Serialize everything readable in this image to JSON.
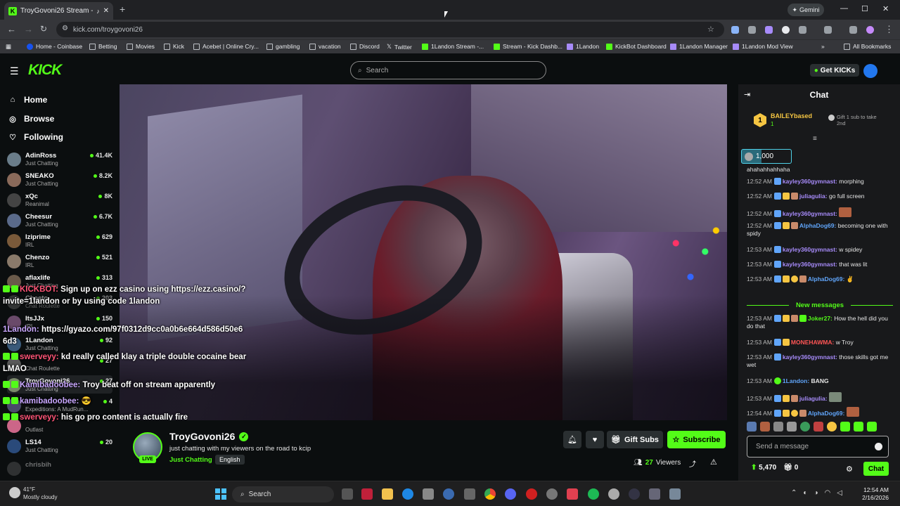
{
  "browser": {
    "tab_title": "TroyGovoni26 Stream - Wa",
    "url": "kick.com/troygovoni26",
    "gemini_label": "Gemini",
    "bookmarks": [
      {
        "label": "Home - Coinbase"
      },
      {
        "label": "Betting"
      },
      {
        "label": "Movies"
      },
      {
        "label": "Kick"
      },
      {
        "label": "Acebet | Online Cry..."
      },
      {
        "label": "gambling"
      },
      {
        "label": "vacation"
      },
      {
        "label": "Discord"
      },
      {
        "label": "Twitter"
      },
      {
        "label": "1Landon Stream -..."
      },
      {
        "label": "Stream - Kick Dashb..."
      },
      {
        "label": "1Landon"
      },
      {
        "label": "KickBot Dashboard"
      },
      {
        "label": "1Landon Manager"
      },
      {
        "label": "1Landon Mod View"
      },
      {
        "label": "All Bookmarks"
      }
    ]
  },
  "header": {
    "logo": "KICK",
    "search_placeholder": "Search",
    "get_kicks": "Get KICKs"
  },
  "sidebar": {
    "nav": [
      {
        "label": "Home",
        "icon": "home-icon"
      },
      {
        "label": "Browse",
        "icon": "compass-icon"
      },
      {
        "label": "Following",
        "icon": "heart-icon"
      }
    ],
    "channels": [
      {
        "name": "AdinRoss",
        "category": "Just Chatting",
        "viewers": "41.4K"
      },
      {
        "name": "SNEAKO",
        "category": "Just Chatting",
        "viewers": "8.2K"
      },
      {
        "name": "xQc",
        "category": "Reanimal",
        "viewers": "8K"
      },
      {
        "name": "Cheesur",
        "category": "Just Chatting",
        "viewers": "6.7K"
      },
      {
        "name": "Iziprime",
        "category": "IRL",
        "viewers": "629"
      },
      {
        "name": "Chenzo",
        "category": "IRL",
        "viewers": "521"
      },
      {
        "name": "aflaxlife",
        "category": "Just Chatting",
        "viewers": "313"
      },
      {
        "name": "Cheeto",
        "category": "Chat Roulette",
        "viewers": "203"
      },
      {
        "name": "ItsJJx",
        "category": "IRL",
        "viewers": "150"
      },
      {
        "name": "1Landon",
        "category": "Just Chatting",
        "viewers": "92"
      },
      {
        "name": "",
        "category": "Chat Roulette",
        "viewers": "27"
      },
      {
        "name": "TroyGovoni26",
        "category": "Just Chatting",
        "viewers": "27"
      },
      {
        "name": "",
        "category": "Expeditions: A MudRun...",
        "viewers": "4"
      },
      {
        "name": "",
        "category": "Outlast",
        "viewers": ""
      },
      {
        "name": "LS14",
        "category": "Just Chatting",
        "viewers": "20"
      },
      {
        "name": "chrisbih",
        "category": "",
        "viewers": ""
      }
    ]
  },
  "overlay_chat": [
    {
      "user": "",
      "text": "Sign up on ezz casino using https://ezz.casino/?"
    },
    {
      "user": "",
      "text": "invite=1landon or by using code 1landon"
    },
    {
      "user": "1Landon:",
      "text": "https://gyazo.com/97f0312d9cc0a0b6e664d586d50e6"
    },
    {
      "user": "",
      "text": "6d3"
    },
    {
      "user": "",
      "text": "kd really called klay a triple double cocaine bear"
    },
    {
      "user": "",
      "text": "LMAO"
    },
    {
      "user": "Kamibadoobee:",
      "text": "Troy beat off on stream apparently"
    },
    {
      "user": "kamibadoobee:",
      "text": ""
    },
    {
      "user": "",
      "text": "his go pro content is actually fire"
    }
  ],
  "channel": {
    "name": "TroyGovoni26",
    "live_label": "LIVE",
    "stream_title": "just chatting with my viewers on the road to kcip",
    "category": "Just Chatting",
    "language": "English",
    "gift_subs": "Gift Subs",
    "subscribe": "Subscribe",
    "viewers": "27",
    "viewers_label": "Viewers"
  },
  "chat": {
    "title": "Chat",
    "pinned": {
      "rank": "1",
      "user": "BAILEYbased",
      "amount": "1",
      "note": "Gift 1 sub to take 2nd"
    },
    "goal": "1,000",
    "messages": [
      {
        "time": "",
        "user": "",
        "text": "ahahahhahhaha",
        "style": "u1"
      },
      {
        "time": "12:52 AM",
        "user": "kayley360gymnast:",
        "text": "morphing",
        "style": "u1"
      },
      {
        "time": "12:52 AM",
        "user": "juliagulia:",
        "text": "go full screen",
        "style": "u1"
      },
      {
        "time": "12:52 AM",
        "user": "kayley360gymnast:",
        "text": "",
        "style": "u1"
      },
      {
        "time": "12:52 AM",
        "user": "AlphaDog69:",
        "text": "becoming one with spidy",
        "style": "u4"
      },
      {
        "time": "12:53 AM",
        "user": "kayley360gymnast:",
        "text": "w spidey",
        "style": "u1"
      },
      {
        "time": "12:53 AM",
        "user": "kayley360gymnast:",
        "text": "that was lit",
        "style": "u1"
      },
      {
        "time": "12:53 AM",
        "user": "AlphaDog69:",
        "text": "",
        "style": "u4"
      },
      {
        "time": "12:53 AM",
        "user": "Joker27:",
        "text": "How the hell did you do that",
        "style": "u2"
      },
      {
        "time": "12:53 AM",
        "user": "MONEHAWMA:",
        "text": "w Troy",
        "style": "u3"
      },
      {
        "time": "12:53 AM",
        "user": "kayley360gymnast:",
        "text": "those skills got me wet",
        "style": "u1"
      },
      {
        "time": "12:53 AM",
        "user": "1Landon:",
        "text": "BANG",
        "style": "u4"
      },
      {
        "time": "12:53 AM",
        "user": "juliagulia:",
        "text": "",
        "style": "u1"
      },
      {
        "time": "12:54 AM",
        "user": "AlphaDog69:",
        "text": "",
        "style": "u4"
      }
    ],
    "new_messages": "New messages",
    "input_placeholder": "Send a message",
    "points": "5,470",
    "gifts": "0",
    "chat_button": "Chat"
  },
  "taskbar": {
    "temperature": "41°F",
    "weather": "Mostly cloudy",
    "search": "Search",
    "time": "12:54 AM",
    "date": "2/16/2026"
  },
  "colors": {
    "kick_green": "#53fc18",
    "background": "#0b0e0f",
    "chat_bg": "#18191b"
  }
}
